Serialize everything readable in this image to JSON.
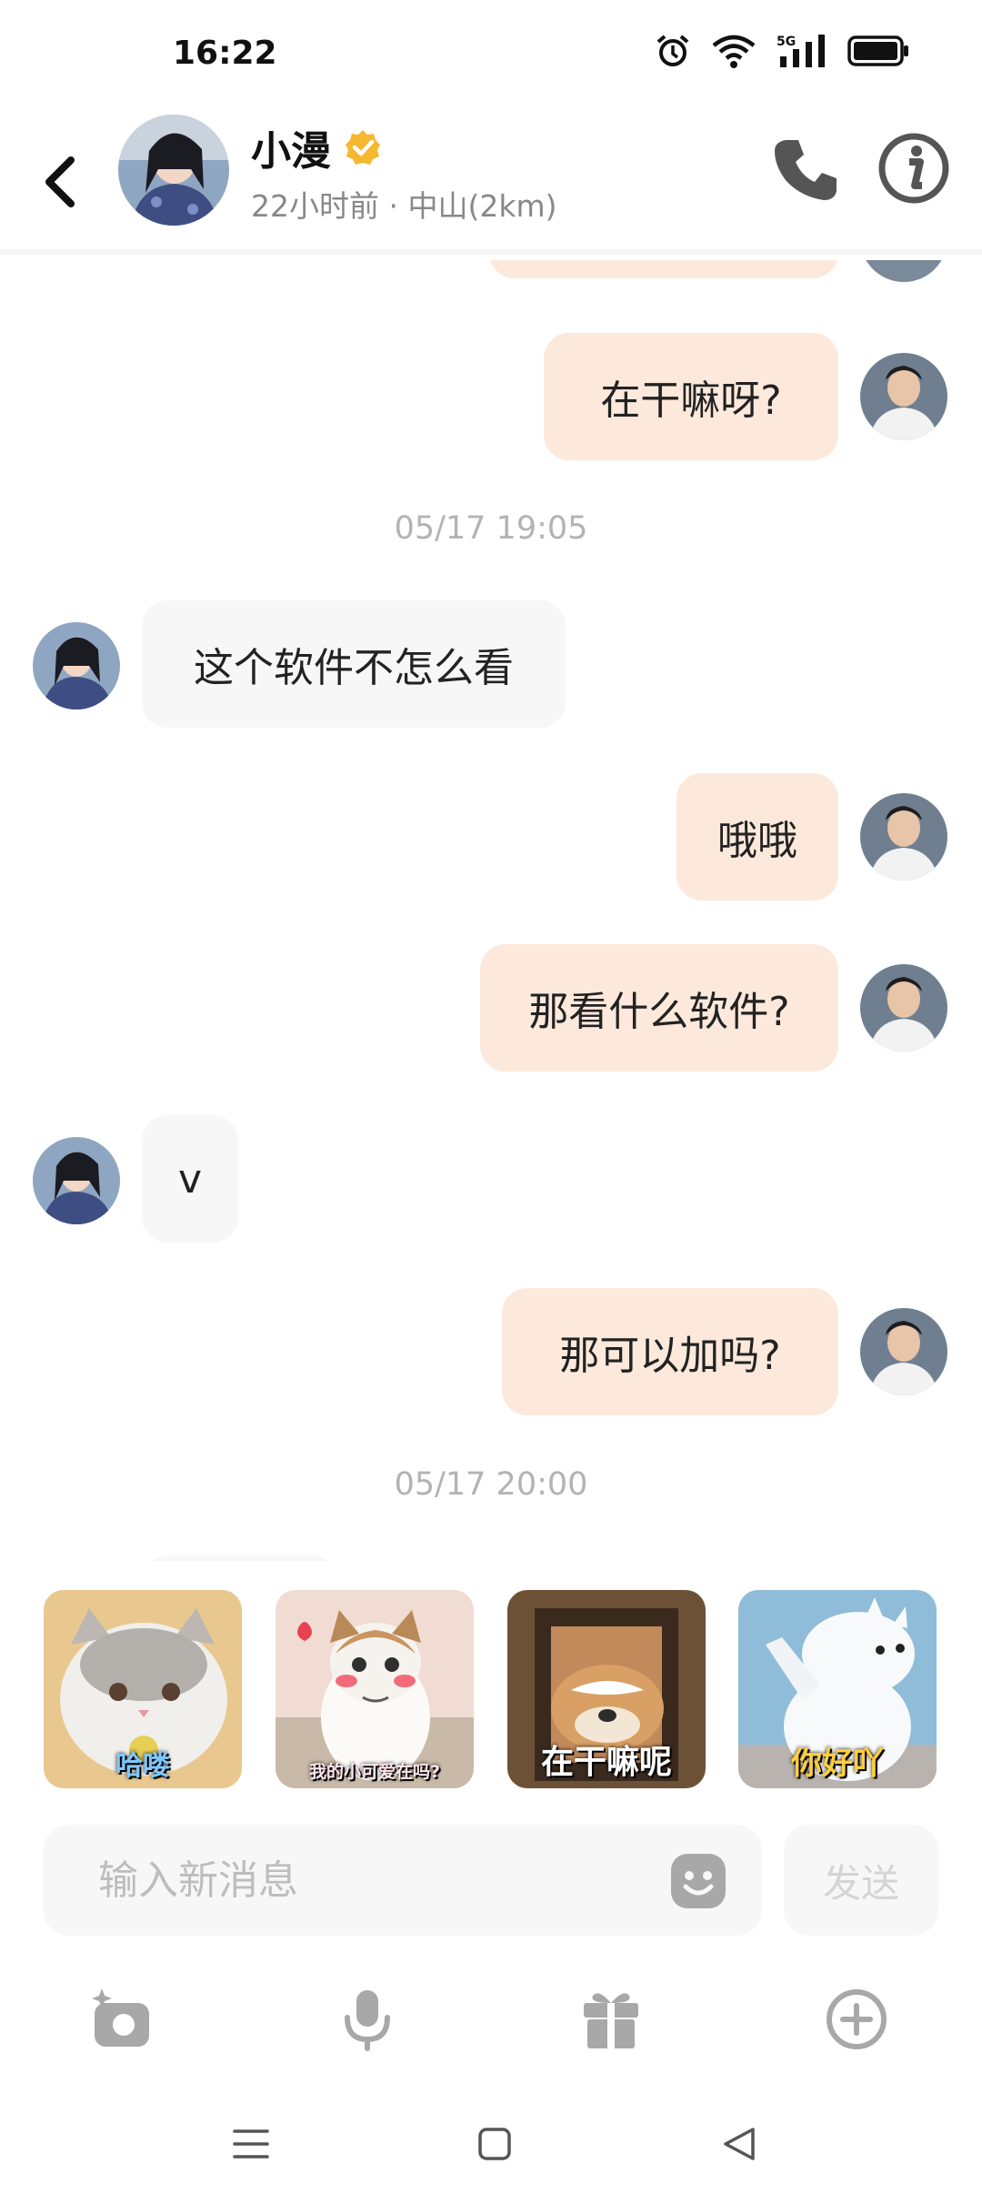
{
  "status_bar": {
    "time": "16:22",
    "network": "5G"
  },
  "header": {
    "name": "小漫",
    "subtitle": "22小时前 · 中山(2km)"
  },
  "messages": [
    {
      "text": "在干嘛呀?"
    },
    {
      "text": "05/17 19:05"
    },
    {
      "text": "这个软件不怎么看"
    },
    {
      "text": "哦哦"
    },
    {
      "text": "那看什么软件?"
    },
    {
      "text": "v"
    },
    {
      "text": "那可以加吗?"
    },
    {
      "text": "05/17 20:00"
    }
  ],
  "stickers": [
    {
      "caption": "哈喽"
    },
    {
      "caption": "我的小可爱在吗?"
    },
    {
      "caption": "在干嘛呢"
    },
    {
      "caption": "你好吖"
    }
  ],
  "input": {
    "placeholder": "输入新消息",
    "send_label": "发送"
  },
  "colors": {
    "accent": "#f5b82e",
    "outgoing_bubble": "#fde9dc",
    "incoming_bubble": "#f7f7f7"
  }
}
